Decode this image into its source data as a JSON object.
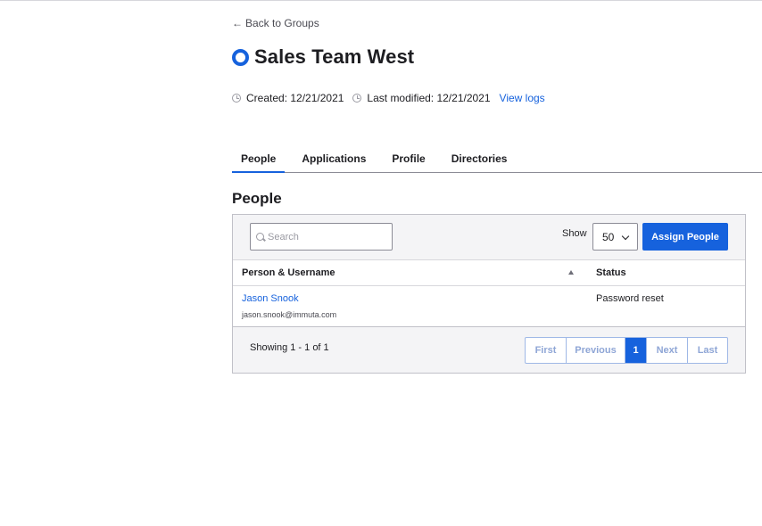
{
  "nav": {
    "back_arrow": "←",
    "back_label": "Back to Groups"
  },
  "group": {
    "title": "Sales Team West",
    "icon": "group-ring-icon",
    "created": "Created: 12/21/2021",
    "modified": "Last modified: 12/21/2021",
    "view_logs": "View logs"
  },
  "tabs": [
    {
      "label": "People",
      "active": true
    },
    {
      "label": "Applications",
      "active": false
    },
    {
      "label": "Profile",
      "active": false
    },
    {
      "label": "Directories",
      "active": false
    }
  ],
  "section": {
    "title": "People"
  },
  "toolbar": {
    "search_placeholder": "Search",
    "show_label": "Show",
    "show_value": "50",
    "assign_label": "Assign People"
  },
  "table": {
    "headers": {
      "person": "Person & Username",
      "status": "Status"
    },
    "rows": [
      {
        "name": "Jason Snook",
        "username": "jason.snook@immuta.com",
        "status": "Password reset"
      }
    ]
  },
  "footer": {
    "showing": "Showing 1 - 1 of 1",
    "pager": {
      "first": "First",
      "previous": "Previous",
      "current": "1",
      "next": "Next",
      "last": "Last"
    }
  },
  "colors": {
    "accent": "#1662dd",
    "text": "#1d1d21",
    "border": "#c1c1c8"
  }
}
